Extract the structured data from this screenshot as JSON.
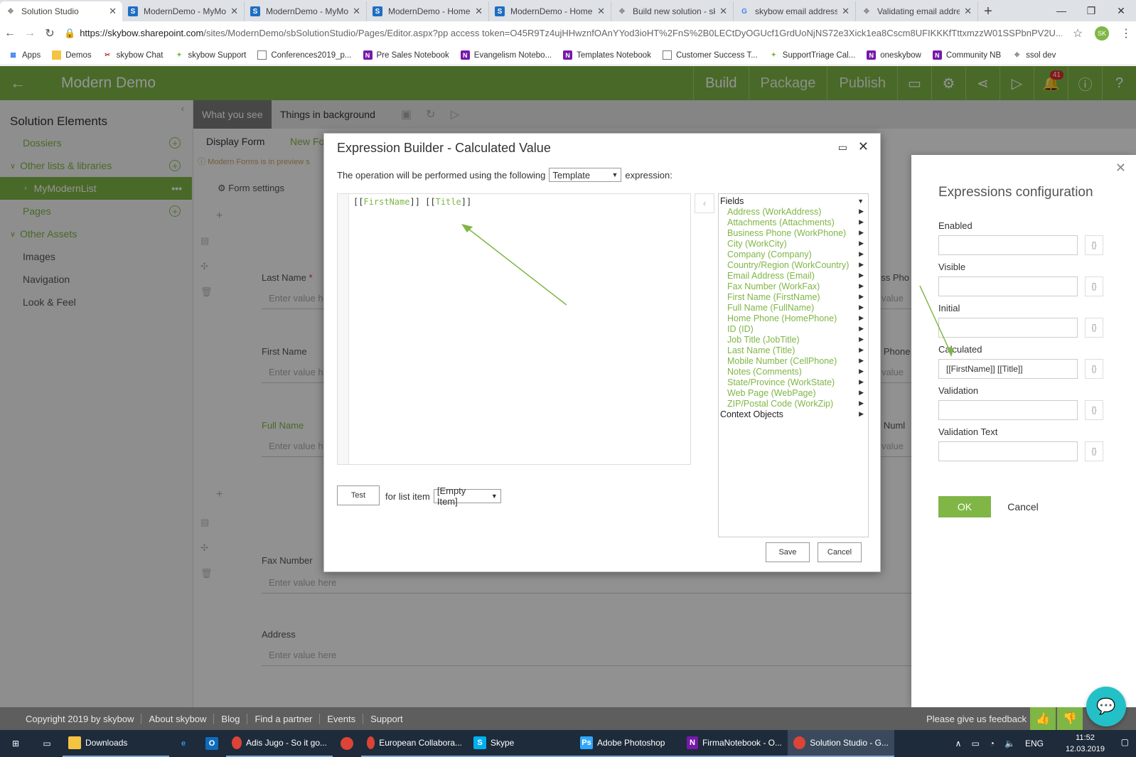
{
  "browser": {
    "tabs": [
      {
        "title": "Solution Studio",
        "icon": "puzzle-icon"
      },
      {
        "title": "ModernDemo - MyMo",
        "icon": "sharepoint-icon"
      },
      {
        "title": "ModernDemo - MyMo",
        "icon": "sharepoint-icon"
      },
      {
        "title": "ModernDemo - Home",
        "icon": "sharepoint-icon"
      },
      {
        "title": "ModernDemo - Home",
        "icon": "sharepoint-icon"
      },
      {
        "title": "Build new solution - sk",
        "icon": "puzzle-icon"
      },
      {
        "title": "skybow email address",
        "icon": "google-icon"
      },
      {
        "title": "Validating email addre",
        "icon": "puzzle-icon"
      }
    ],
    "url_domain": "https://skybow.sharepoint.com",
    "url_path": "/sites/ModernDemo/sbSolutionStudio/Pages/Editor.aspx?pp access token=O45R9Tz4ujHHwznfOAnYYod3ioHT%2FnS%2B0LECtDyOGUcf1GrdUoNjNS72e3Xick1ea8Cscm8UFIKKKfTttxmzzW01SSPbnPV2U...",
    "profile_initials": "SK",
    "bookmarks": [
      {
        "label": "Apps",
        "icon": "apps-grid-icon"
      },
      {
        "label": "Demos",
        "icon": "folder-icon"
      },
      {
        "label": "skybow Chat",
        "icon": "skybow-icon"
      },
      {
        "label": "skybow Support",
        "icon": "skybow-icon"
      },
      {
        "label": "Conferences2019_p...",
        "icon": "page-icon"
      },
      {
        "label": "Pre Sales Notebook",
        "icon": "onenote-icon"
      },
      {
        "label": "Evangelism Notebo...",
        "icon": "onenote-icon"
      },
      {
        "label": "Templates Notebook",
        "icon": "onenote-icon"
      },
      {
        "label": "Customer Success T...",
        "icon": "page-icon"
      },
      {
        "label": "SupportTriage  Cal...",
        "icon": "page-icon"
      },
      {
        "label": "oneskybow",
        "icon": "onenote-icon"
      },
      {
        "label": "Community NB",
        "icon": "onenote-icon"
      },
      {
        "label": "ssol dev",
        "icon": "puzzle-icon"
      }
    ]
  },
  "app": {
    "name": "Modern Demo",
    "nav": [
      "Build",
      "Package",
      "Publish"
    ],
    "notification_count": "41"
  },
  "sidebar": {
    "title": "Solution Elements",
    "items": [
      {
        "label": "Dossiers"
      },
      {
        "label": "Other lists & libraries"
      },
      {
        "label": "MyModernList"
      },
      {
        "label": "Pages"
      },
      {
        "label": "Other Assets"
      },
      {
        "label": "Images"
      },
      {
        "label": "Navigation"
      },
      {
        "label": "Look & Feel"
      }
    ]
  },
  "toolbar": {
    "tab_what": "What you see",
    "tab_background": "Things in background"
  },
  "form": {
    "tabs": [
      "Display Form",
      "New Fo"
    ],
    "preview_notice": "Modern Forms is in preview s",
    "settings_label": "Form settings",
    "fields": [
      {
        "label": "Last Name",
        "required": "*",
        "placeholder": "Enter value h"
      },
      {
        "label": "First Name",
        "placeholder": "Enter value h"
      },
      {
        "label": "Full Name",
        "placeholder": "Enter value h"
      },
      {
        "label": "Fax Number",
        "placeholder": "Enter value here"
      },
      {
        "label": "Address",
        "placeholder": "Enter value here"
      }
    ],
    "right_fields": [
      {
        "label": "ess Pho",
        "placeholder": "r value"
      },
      {
        "label": "e Phone",
        "placeholder": "r value"
      },
      {
        "label": "e Numl",
        "placeholder": "r value"
      }
    ]
  },
  "expressions_panel": {
    "title": "Expressions configuration",
    "fields": [
      {
        "label": "Enabled",
        "value": ""
      },
      {
        "label": "Visible",
        "value": ""
      },
      {
        "label": "Initial",
        "value": ""
      },
      {
        "label": "Calculated",
        "value": "[[FirstName]] [[Title]]"
      },
      {
        "label": "Validation",
        "value": ""
      },
      {
        "label": "Validation Text",
        "value": ""
      }
    ],
    "brace_label": "{}",
    "ok": "OK",
    "cancel": "Cancel"
  },
  "dialog": {
    "title": "Expression Builder - Calculated Value",
    "op_prefix": "The operation will be performed using the following",
    "op_type": "Template",
    "op_suffix": "expression:",
    "code_parts": [
      "[[",
      "FirstName",
      "]] [[",
      "Title",
      "]]"
    ],
    "tree": {
      "fields_label": "Fields",
      "fields": [
        "Address (WorkAddress)",
        "Attachments (Attachments)",
        "Business Phone (WorkPhone)",
        "City (WorkCity)",
        "Company (Company)",
        "Country/Region (WorkCountry)",
        "Email Address (Email)",
        "Fax Number (WorkFax)",
        "First Name (FirstName)",
        "Full Name (FullName)",
        "Home Phone (HomePhone)",
        "ID (ID)",
        "Job Title (JobTitle)",
        "Last Name (Title)",
        "Mobile Number (CellPhone)",
        "Notes (Comments)",
        "State/Province (WorkState)",
        "Web Page (WebPage)",
        "ZIP/Postal Code (WorkZip)"
      ],
      "context_label": "Context Objects"
    },
    "test": "Test",
    "for_item": "for list item",
    "list_item": "[Empty Item]",
    "save": "Save",
    "cancel": "Cancel"
  },
  "footer": {
    "links": [
      "Copyright 2019 by skybow",
      "About skybow",
      "Blog",
      "Find a partner",
      "Events",
      "Support"
    ],
    "feedback": "Please give us feedback"
  },
  "taskbar": {
    "items": [
      {
        "label": "Downloads",
        "icon": "folder-icon"
      },
      {
        "label": "",
        "icon": "edge-icon"
      },
      {
        "label": "",
        "icon": "outlook-icon"
      },
      {
        "label": "Adis Jugo - So it go...",
        "icon": "chrome-icon"
      },
      {
        "label": "",
        "icon": "chrome-icon"
      },
      {
        "label": "European Collabora...",
        "icon": "chrome-icon"
      },
      {
        "label": "Skype",
        "icon": "skype-icon"
      },
      {
        "label": "Adobe Photoshop",
        "icon": "photoshop-icon"
      },
      {
        "label": "FirmaNotebook - O...",
        "icon": "onenote-icon"
      },
      {
        "label": "Solution Studio - G...",
        "icon": "chrome-icon"
      }
    ],
    "lang": "ENG",
    "time": "11:52",
    "date": "12.03.2019"
  },
  "colors": {
    "brand": "#7fb646",
    "accent_link": "#7fb646",
    "badge": "#e02b2b"
  }
}
